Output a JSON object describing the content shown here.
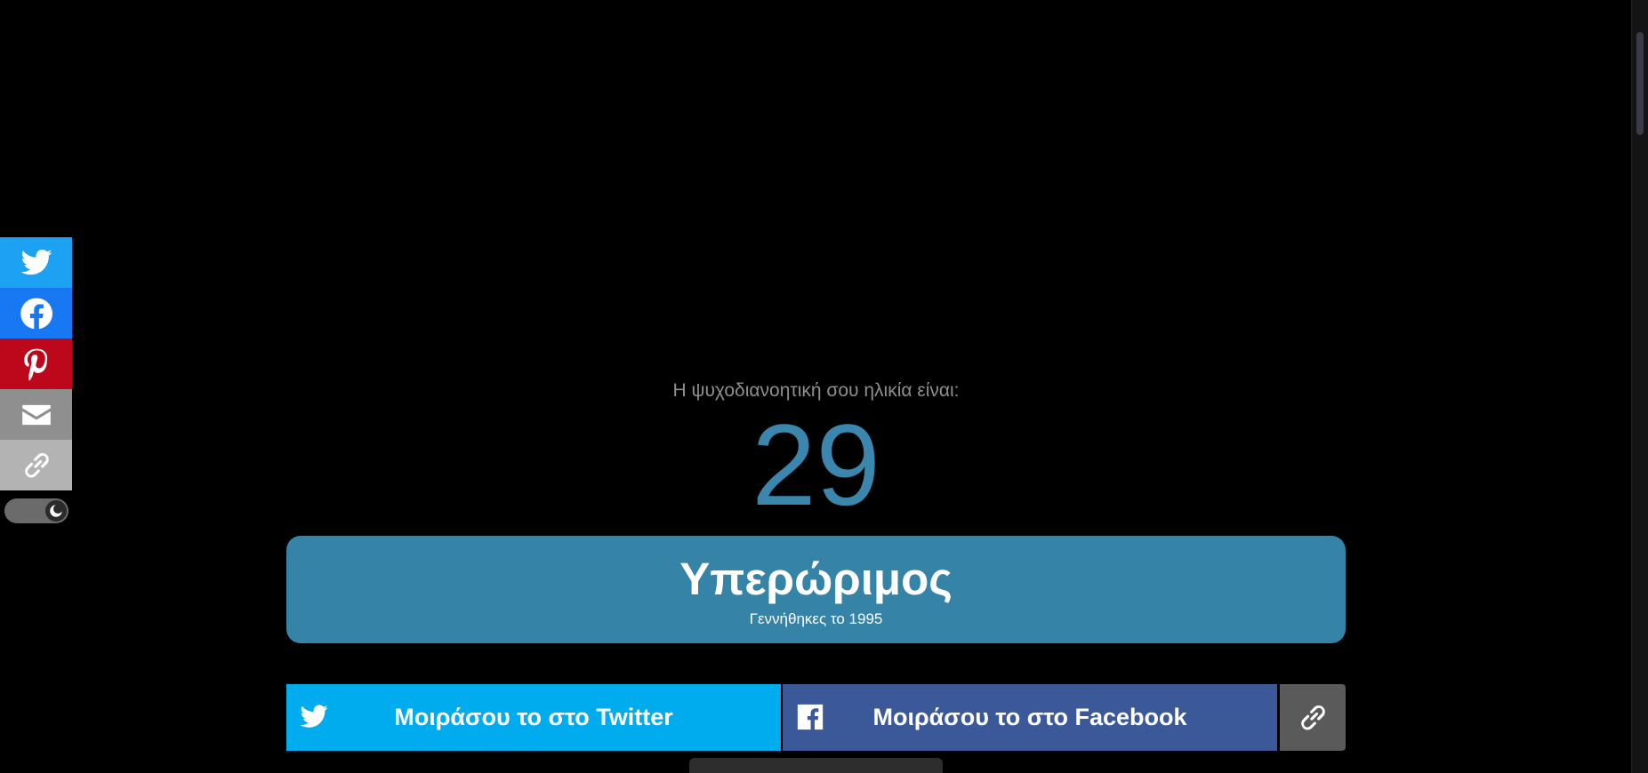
{
  "result": {
    "label": "Η ψυχοδιανοητική σου ηλικία είναι:",
    "age": "29",
    "title": "Υπερώριμος",
    "subtitle": "Γεννήθηκες το 1995"
  },
  "share": {
    "twitter_label": "Μοιράσου το στο Twitter",
    "facebook_label": "Μοιράσου το στο Facebook"
  },
  "share_rail": {
    "items": [
      "twitter-icon",
      "facebook-icon",
      "pinterest-icon",
      "email-icon",
      "link-icon"
    ]
  },
  "colors": {
    "accent": "#3683a8",
    "twitter": "#00acee",
    "facebook": "#3b5998",
    "pinterest": "#bd081c"
  }
}
